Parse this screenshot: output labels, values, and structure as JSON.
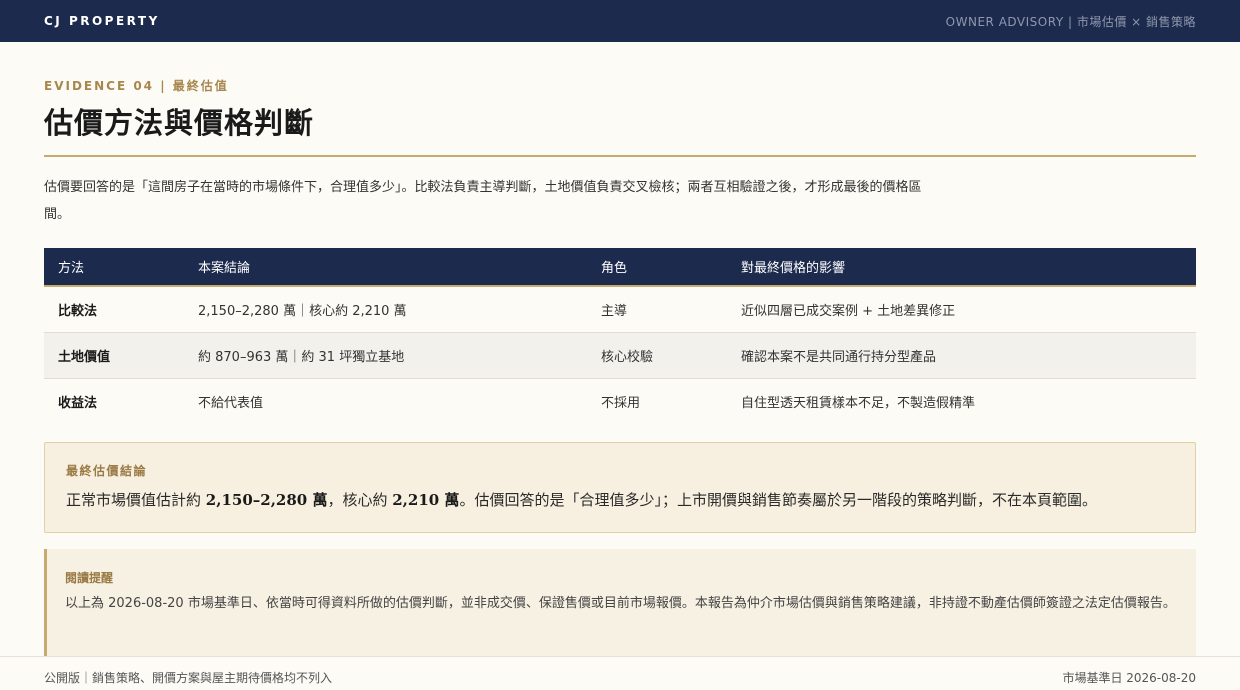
{
  "header": {
    "brand": "CJ PROPERTY",
    "advisory": "OWNER ADVISORY | 市場估價 × 銷售策略"
  },
  "section": {
    "eyebrow": "EVIDENCE 04 | 最終估值",
    "title": "估價方法與價格判斷",
    "intro": "估價要回答的是「這間房子在當時的市場條件下，合理值多少」。比較法負責主導判斷，土地價值負責交叉檢核；兩者互相驗證之後，才形成最後的價格區間。"
  },
  "table": {
    "headers": [
      "方法",
      "本案結論",
      "角色",
      "對最終價格的影響"
    ],
    "rows": [
      {
        "method": "比較法",
        "conclusion": "2,150–2,280 萬｜核心約 2,210 萬",
        "role": "主導",
        "impact": "近似四層已成交案例 + 土地差異修正"
      },
      {
        "method": "土地價值",
        "conclusion": "約 870–963 萬｜約 31 坪獨立基地",
        "role": "核心校驗",
        "impact": "確認本案不是共同通行持分型產品"
      },
      {
        "method": "收益法",
        "conclusion": "不給代表值",
        "role": "不採用",
        "impact": "自住型透天租賃樣本不足，不製造假精準"
      }
    ]
  },
  "conclusion": {
    "label": "最終估價結論",
    "pre": "正常市場價值估計約 ",
    "range": "2,150–2,280 萬",
    "mid": "，核心約 ",
    "core": "2,210 萬",
    "post": "。估價回答的是「合理值多少」；上市開價與銷售節奏屬於另一階段的策略判斷，不在本頁範圍。"
  },
  "reminder": {
    "label": "閱讀提醒",
    "text": "以上為 2026-08-20 市場基準日、依當時可得資料所做的估價判斷，並非成交價、保證售價或目前市場報價。本報告為仲介市場估價與銷售策略建議，非持證不動產估價師簽證之法定估價報告。"
  },
  "footer": {
    "left": "公開版｜銷售策略、開價方案與屋主期待價格均不列入",
    "right": "市場基準日 2026-08-20"
  }
}
